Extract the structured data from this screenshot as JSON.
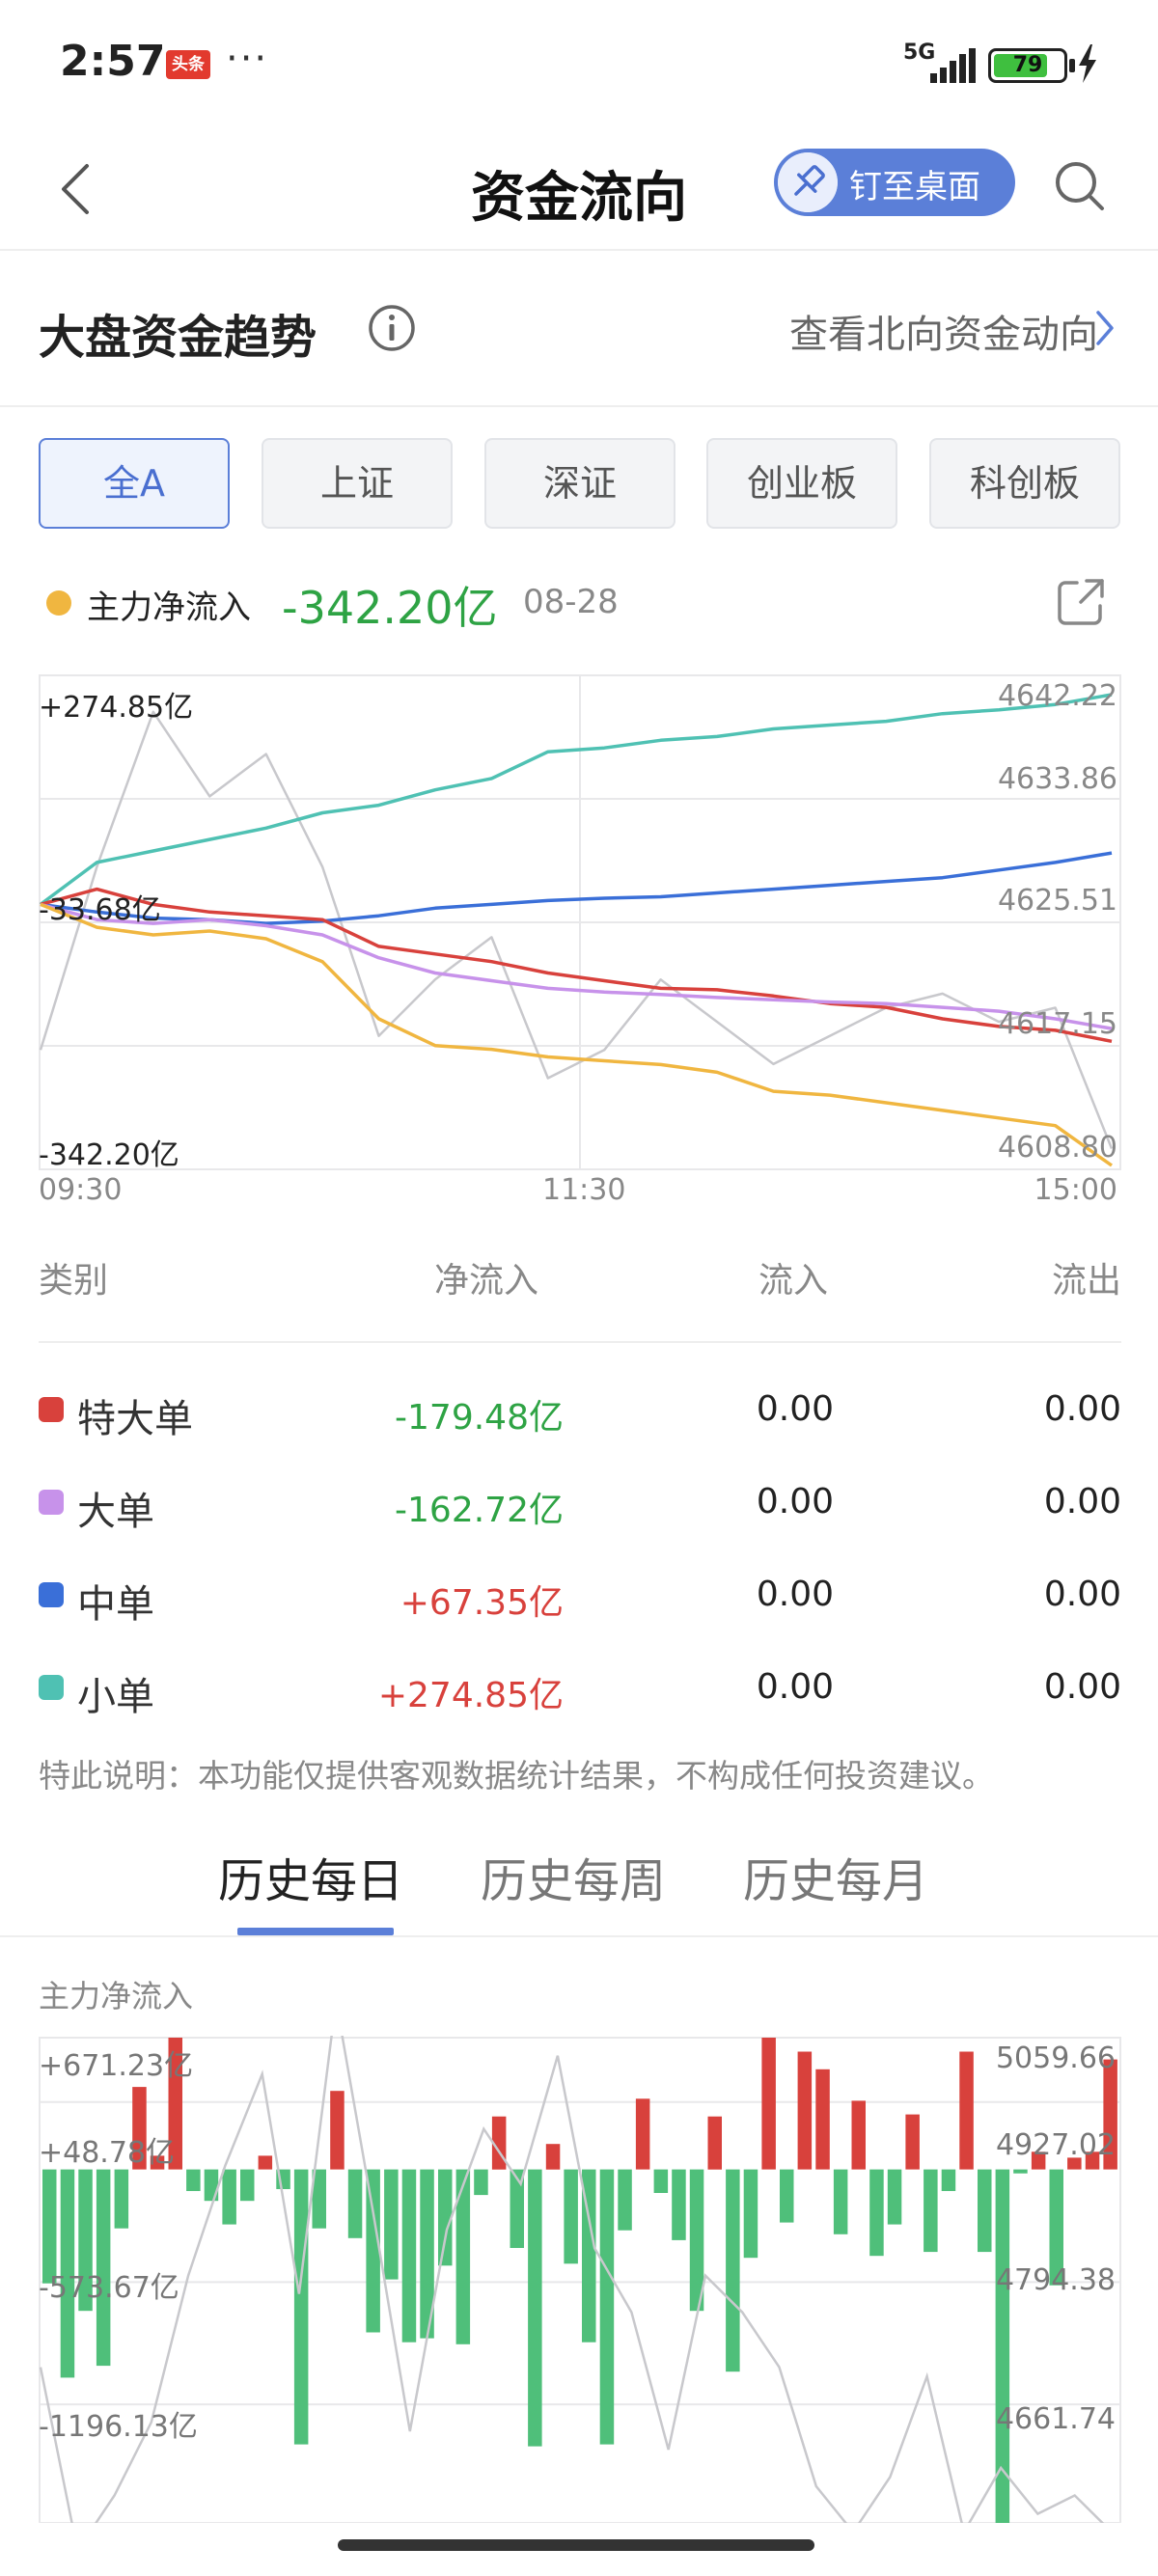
{
  "status_bar": {
    "time": "2:57",
    "app_badge": "头条",
    "more": "···",
    "network": "5G",
    "battery": 79,
    "battery_text": "79"
  },
  "nav": {
    "title": "资金流向",
    "pin_label": "钉至桌面"
  },
  "section": {
    "title": "大盘资金趋势",
    "link": "查看北向资金动向"
  },
  "tabs": [
    "全A",
    "上证",
    "深证",
    "创业板",
    "科创板"
  ],
  "active_tab": 0,
  "inflow": {
    "label": "主力净流入",
    "value": "-342.20亿",
    "date": "08-28"
  },
  "colors": {
    "super_large": "#d8413c",
    "large": "#c792ea",
    "medium": "#3a6fd8",
    "small": "#4fc1b3",
    "main": "#f0b640",
    "index": "#c8c8cc",
    "positive": "#d8413c",
    "negative": "#2ea344",
    "accent": "#5b7fd8"
  },
  "chart_data": [
    {
      "type": "line",
      "x_labels": [
        "09:30",
        "11:30",
        "15:00"
      ],
      "left_axis_labels": [
        "+274.85亿",
        "-33.68亿",
        "-342.20亿"
      ],
      "right_axis_labels": [
        "4642.22",
        "4633.86",
        "4625.51",
        "4617.15",
        "4608.80"
      ],
      "left_range": [
        -342.2,
        274.85
      ],
      "right_range": [
        4608.8,
        4642.22
      ],
      "series": [
        {
          "key": "small",
          "values": [
            0,
            55,
            70,
            85,
            100,
            120,
            130,
            150,
            165,
            200,
            205,
            215,
            220,
            230,
            235,
            240,
            250,
            255,
            262,
            274.85
          ]
        },
        {
          "key": "medium",
          "values": [
            0,
            -10,
            -18,
            -20,
            -25,
            -22,
            -15,
            -5,
            0,
            5,
            8,
            10,
            15,
            20,
            25,
            30,
            35,
            45,
            55,
            67.35
          ]
        },
        {
          "key": "super_large",
          "values": [
            0,
            20,
            0,
            -10,
            -15,
            -20,
            -55,
            -65,
            -75,
            -90,
            -100,
            -110,
            -112,
            -120,
            -130,
            -135,
            -150,
            -160,
            -165,
            -179.48
          ]
        },
        {
          "key": "large",
          "values": [
            0,
            -20,
            -25,
            -20,
            -28,
            -40,
            -70,
            -90,
            -100,
            -110,
            -115,
            -118,
            -122,
            -125,
            -128,
            -130,
            -135,
            -140,
            -150,
            -162.72
          ]
        },
        {
          "key": "main",
          "values": [
            0,
            -30,
            -40,
            -35,
            -45,
            -75,
            -150,
            -185,
            -190,
            -200,
            -205,
            -210,
            -220,
            -245,
            -250,
            -260,
            -270,
            -280,
            -290,
            -342.2
          ]
        },
        {
          "key": "index",
          "axis": "right",
          "values": [
            4617,
            4630,
            4641,
            4635,
            4638,
            4630,
            4618,
            4622,
            4625,
            4615,
            4617,
            4622,
            4619,
            4616,
            4618,
            4620,
            4621,
            4619,
            4620,
            4610
          ]
        }
      ]
    },
    {
      "type": "bar",
      "title": "主力净流入",
      "left_axis_labels": [
        "+671.23亿",
        "+48.78亿",
        "-573.67亿",
        "-1196.13亿"
      ],
      "right_axis_labels": [
        "5059.66",
        "4927.02",
        "4794.38",
        "4661.74"
      ],
      "left_range": [
        -1800,
        671.23
      ],
      "right_range": [
        4530,
        5059.66
      ],
      "values": [
        -580,
        -1060,
        -720,
        -1000,
        -300,
        420,
        70,
        671,
        -110,
        -160,
        -280,
        -160,
        70,
        -100,
        -1400,
        -300,
        400,
        -350,
        -830,
        -560,
        -880,
        -860,
        -490,
        -890,
        -130,
        270,
        -400,
        -1410,
        130,
        -480,
        -880,
        -1400,
        -310,
        360,
        -120,
        -360,
        -720,
        270,
        -1030,
        -450,
        671,
        -270,
        600,
        510,
        -330,
        350,
        -440,
        -280,
        280,
        -420,
        -110,
        600,
        -420,
        -1830,
        -20,
        90,
        -590,
        60,
        90,
        560
      ],
      "line": [
        4700,
        4500,
        4560,
        4640,
        4800,
        4920,
        5020,
        4780,
        5100,
        4870,
        4630,
        4850,
        4960,
        4900,
        5040,
        4830,
        4760,
        4610,
        4800,
        4760,
        4700,
        4570,
        4520,
        4580,
        4690,
        4520,
        4590,
        4540,
        4560,
        4520
      ]
    }
  ],
  "table": {
    "headers": [
      "类别",
      "净流入",
      "流入",
      "流出"
    ],
    "rows": [
      {
        "name": "特大单",
        "net": "-179.48亿",
        "in": "0.00",
        "out": "0.00",
        "sign": "neg",
        "key": "super_large"
      },
      {
        "name": "大单",
        "net": "-162.72亿",
        "in": "0.00",
        "out": "0.00",
        "sign": "neg",
        "key": "large"
      },
      {
        "name": "中单",
        "net": "+67.35亿",
        "in": "0.00",
        "out": "0.00",
        "sign": "pos",
        "key": "medium"
      },
      {
        "name": "小单",
        "net": "+274.85亿",
        "in": "0.00",
        "out": "0.00",
        "sign": "pos",
        "key": "small"
      }
    ]
  },
  "disclaimer": "特此说明：本功能仅提供客观数据统计结果，不构成任何投资建议。",
  "history_tabs": [
    "历史每日",
    "历史每周",
    "历史每月"
  ],
  "active_history_tab": 0
}
